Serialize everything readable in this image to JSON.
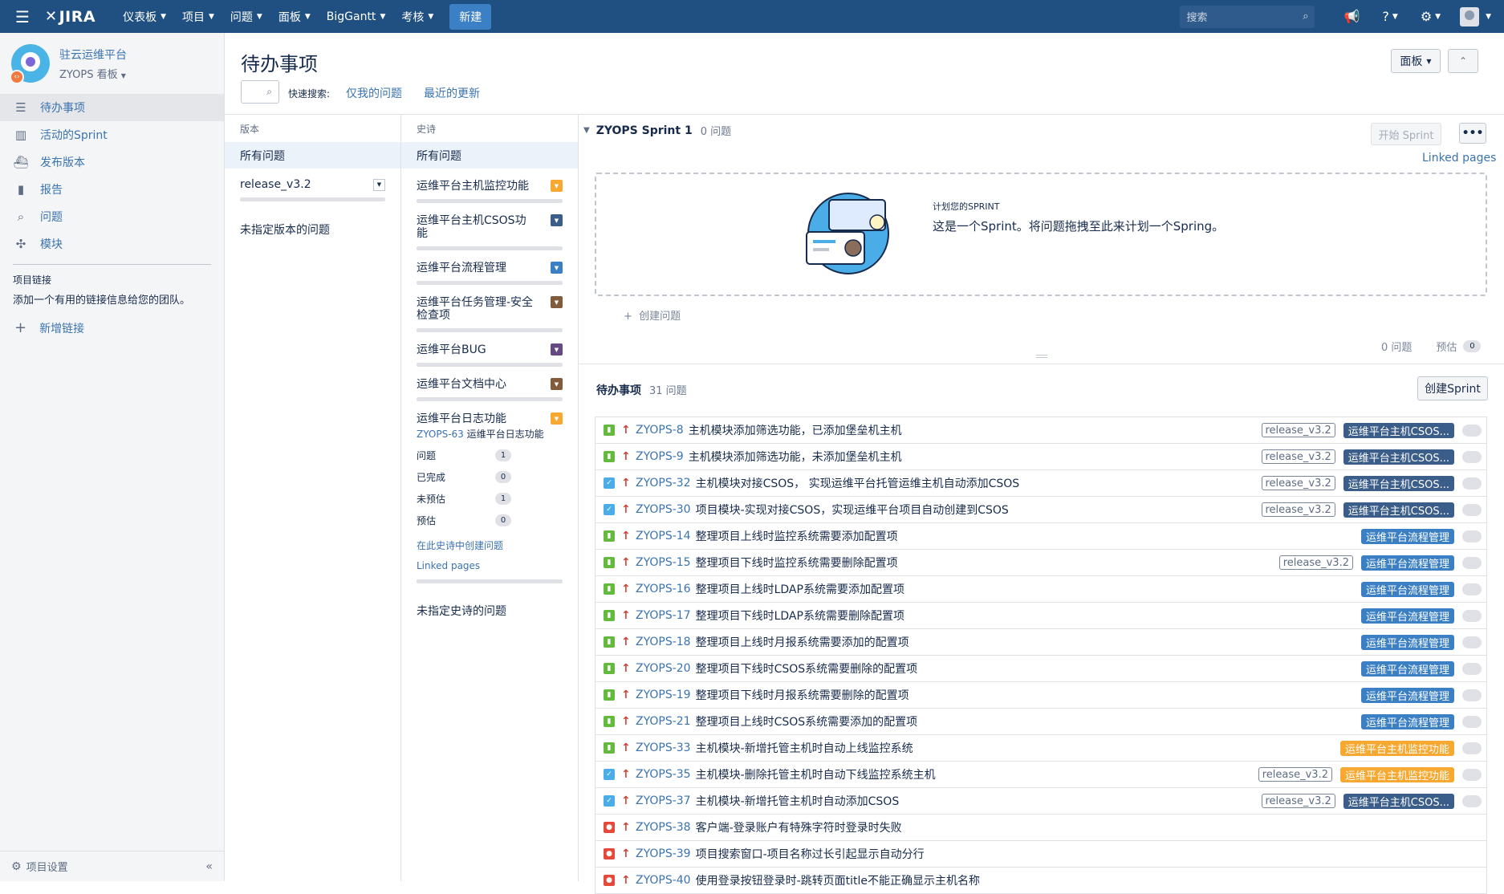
{
  "topnav": {
    "logo": "JIRA",
    "menu": [
      "仪表板",
      "项目",
      "问题",
      "面板",
      "BigGantt",
      "考核"
    ],
    "create": "新建",
    "search_placeholder": "搜索",
    "colors": {
      "bar": "#205081",
      "create": "#3b7fc4"
    }
  },
  "sidebar": {
    "project_name": "驻云运维平台",
    "board_name": "ZYOPS 看板",
    "nav": [
      {
        "label": "待办事项",
        "icon": "backlog-icon",
        "active": true
      },
      {
        "label": "活动的Sprint",
        "icon": "board-icon"
      },
      {
        "label": "发布版本",
        "icon": "ship-icon"
      },
      {
        "label": "报告",
        "icon": "chart-icon"
      },
      {
        "label": "问题",
        "icon": "search-issues-icon"
      },
      {
        "label": "模块",
        "icon": "puzzle-icon"
      }
    ],
    "links_header": "项目链接",
    "links_desc": "添加一个有用的链接信息给您的团队。",
    "add_link": "新增链接",
    "settings": "项目设置"
  },
  "page": {
    "title": "待办事项",
    "quick_search_label": "快速搜索:",
    "quick_filters": [
      "仅我的问题",
      "最近的更新"
    ],
    "board_button": "面板"
  },
  "versions": {
    "header": "版本",
    "all": "所有问题",
    "items": [
      "release_v3.2"
    ],
    "none": "未指定版本的问题"
  },
  "epics": {
    "header": "史诗",
    "all": "所有问题",
    "items": [
      {
        "name": "运维平台主机监控功能",
        "color": "#f6a830"
      },
      {
        "name": "运维平台主机CSOS功能",
        "color": "#3b5d89"
      },
      {
        "name": "运维平台流程管理",
        "color": "#3b7fc4"
      },
      {
        "name": "运维平台任务管理-安全检查项",
        "color": "#815b3a"
      },
      {
        "name": "运维平台BUG",
        "color": "#654982"
      },
      {
        "name": "运维平台文档中心",
        "color": "#815b3a"
      }
    ],
    "expanded": {
      "name": "运维平台日志功能",
      "color": "#f6a830",
      "key": "ZYOPS-63",
      "summary": "运维平台日志功能",
      "stats": [
        {
          "label": "问题",
          "value": "1"
        },
        {
          "label": "已完成",
          "value": "0"
        },
        {
          "label": "未预估",
          "value": "1"
        },
        {
          "label": "预估",
          "value": "0"
        }
      ],
      "create_link": "在此史诗中创建问题",
      "linked_pages": "Linked pages"
    },
    "none": "未指定史诗的问题"
  },
  "sprint": {
    "name": "ZYOPS Sprint 1",
    "count": "0 问题",
    "start_button": "开始 Sprint",
    "more_button": "•••",
    "linked_pages": "Linked pages",
    "plan_heading": "计划您的SPRINT",
    "plan_text": "这是一个Sprint。将问题拖拽至此来计划一个Spring。",
    "create_issue": "创建问题",
    "footer_count": "0 问题",
    "footer_est_label": "预估",
    "footer_est_value": "0"
  },
  "backlog": {
    "title": "待办事项",
    "count": "31 问题",
    "create_sprint": "创建Sprint",
    "issues": [
      {
        "type": "story",
        "key": "ZYOPS-8",
        "summary": "主机模块添加筛选功能，已添加堡垒机主机",
        "version": "release_v3.2",
        "epic": "运维平台主机CSOS...",
        "epic_color": "#3b5d89"
      },
      {
        "type": "story",
        "key": "ZYOPS-9",
        "summary": "主机模块添加筛选功能，未添加堡垒机主机",
        "version": "release_v3.2",
        "epic": "运维平台主机CSOS...",
        "epic_color": "#3b5d89"
      },
      {
        "type": "task",
        "key": "ZYOPS-32",
        "summary": "主机模块对接CSOS， 实现运维平台托管运维主机自动添加CSOS",
        "version": "release_v3.2",
        "epic": "运维平台主机CSOS...",
        "epic_color": "#3b5d89"
      },
      {
        "type": "task",
        "key": "ZYOPS-30",
        "summary": "项目模块-实现对接CSOS，实现运维平台项目自动创建到CSOS",
        "version": "release_v3.2",
        "epic": "运维平台主机CSOS...",
        "epic_color": "#3b5d89"
      },
      {
        "type": "story",
        "key": "ZYOPS-14",
        "summary": "整理项目上线时监控系统需要添加配置项",
        "version": "",
        "epic": "运维平台流程管理",
        "epic_color": "#3b7fc4"
      },
      {
        "type": "story",
        "key": "ZYOPS-15",
        "summary": "整理项目下线时监控系统需要删除配置项",
        "version": "release_v3.2",
        "epic": "运维平台流程管理",
        "epic_color": "#3b7fc4"
      },
      {
        "type": "story",
        "key": "ZYOPS-16",
        "summary": "整理项目上线时LDAP系统需要添加配置项",
        "version": "",
        "epic": "运维平台流程管理",
        "epic_color": "#3b7fc4"
      },
      {
        "type": "story",
        "key": "ZYOPS-17",
        "summary": "整理项目下线时LDAP系统需要删除配置项",
        "version": "",
        "epic": "运维平台流程管理",
        "epic_color": "#3b7fc4"
      },
      {
        "type": "story",
        "key": "ZYOPS-18",
        "summary": "整理项目上线时月报系统需要添加的配置项",
        "version": "",
        "epic": "运维平台流程管理",
        "epic_color": "#3b7fc4"
      },
      {
        "type": "story",
        "key": "ZYOPS-20",
        "summary": "整理项目下线时CSOS系统需要删除的配置项",
        "version": "",
        "epic": "运维平台流程管理",
        "epic_color": "#3b7fc4"
      },
      {
        "type": "story",
        "key": "ZYOPS-19",
        "summary": "整理项目下线时月报系统需要删除的配置项",
        "version": "",
        "epic": "运维平台流程管理",
        "epic_color": "#3b7fc4"
      },
      {
        "type": "story",
        "key": "ZYOPS-21",
        "summary": "整理项目上线时CSOS系统需要添加的配置项",
        "version": "",
        "epic": "运维平台流程管理",
        "epic_color": "#3b7fc4"
      },
      {
        "type": "story",
        "key": "ZYOPS-33",
        "summary": "主机模块-新增托管主机时自动上线监控系统",
        "version": "",
        "epic": "运维平台主机监控功能",
        "epic_color": "#f6a830"
      },
      {
        "type": "task",
        "key": "ZYOPS-35",
        "summary": "主机模块-删除托管主机时自动下线监控系统主机",
        "version": "release_v3.2",
        "epic": "运维平台主机监控功能",
        "epic_color": "#f6a830"
      },
      {
        "type": "task",
        "key": "ZYOPS-37",
        "summary": "主机模块-新增托管主机时自动添加CSOS",
        "version": "release_v3.2",
        "epic": "运维平台主机CSOS...",
        "epic_color": "#3b5d89"
      },
      {
        "type": "bug",
        "key": "ZYOPS-38",
        "summary": "客户端-登录账户有特殊字符时登录时失败",
        "version": "",
        "epic": "",
        "epic_color": ""
      },
      {
        "type": "bug",
        "key": "ZYOPS-39",
        "summary": "项目搜索窗口-项目名称过长引起显示自动分行",
        "version": "",
        "epic": "",
        "epic_color": ""
      },
      {
        "type": "bug",
        "key": "ZYOPS-40",
        "summary": "使用登录按钮登录时-跳转页面title不能正确显示主机名称",
        "version": "",
        "epic": "",
        "epic_color": ""
      }
    ]
  }
}
